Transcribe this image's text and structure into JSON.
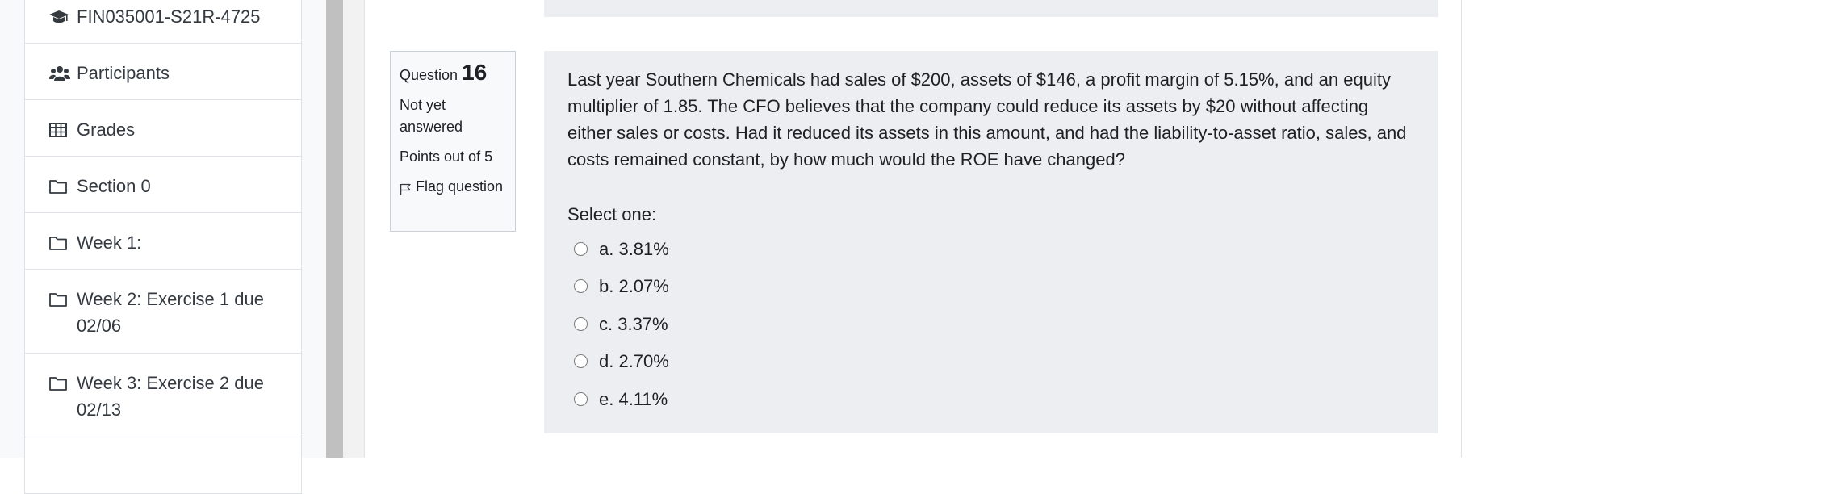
{
  "sidebar": {
    "items": [
      {
        "icon": "graduation-cap-icon",
        "label": "FIN035001-S21R-4725"
      },
      {
        "icon": "users-icon",
        "label": "Participants"
      },
      {
        "icon": "table-icon",
        "label": "Grades"
      },
      {
        "icon": "folder-icon",
        "label": "Section 0"
      },
      {
        "icon": "folder-icon",
        "label": "Week 1:"
      },
      {
        "icon": "folder-icon",
        "label": "Week 2: Exercise 1 due 02/06"
      },
      {
        "icon": "folder-icon",
        "label": "Week 3: Exercise 2 due 02/13"
      }
    ]
  },
  "question": {
    "prefix": "Question",
    "number": "16",
    "state": "Not yet answered",
    "grade": "Points out of 5",
    "flag_label": "Flag question",
    "text": "Last year Southern Chemicals had sales of $200, assets of $146, a profit margin of 5.15%, and an equity multiplier of 1.85. The CFO believes that the company could reduce its assets by $20 without affecting either sales or costs. Had it reduced its assets in this amount, and had the liability-to-asset ratio, sales, and costs remained constant, by how much would the ROE have changed?",
    "prompt": "Select one:",
    "options": [
      {
        "label": "a. 3.81%"
      },
      {
        "label": "b. 2.07%"
      },
      {
        "label": "c. 3.37%"
      },
      {
        "label": "d. 2.70%"
      },
      {
        "label": "e. 4.11%"
      }
    ]
  },
  "colors": {
    "formulation_bg": "#eceef2",
    "info_bg": "#f8f9fa",
    "scrollbar": "#c0c0c0"
  }
}
